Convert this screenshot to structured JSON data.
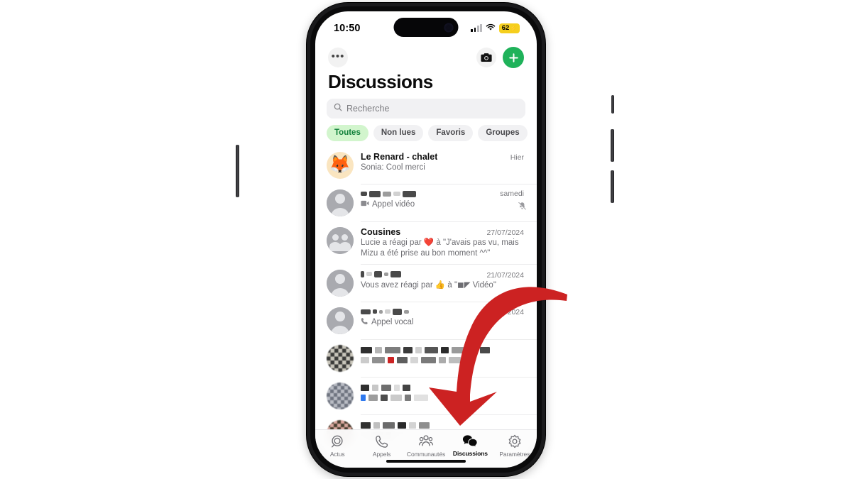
{
  "status_bar": {
    "time": "10:50",
    "battery_level": "62",
    "battery_charging_glyph": "⚡",
    "signal_icon": "cellular-bars-icon",
    "wifi_icon": "wifi-icon"
  },
  "top_nav": {
    "menu_icon": "more-options-icon",
    "menu_label": "•••",
    "camera_icon": "camera-icon",
    "compose_icon": "plus-icon"
  },
  "header": {
    "title": "Discussions"
  },
  "search": {
    "icon": "search-icon",
    "placeholder": "Recherche",
    "value": ""
  },
  "filters": [
    {
      "label": "Toutes",
      "active": true
    },
    {
      "label": "Non lues",
      "active": false
    },
    {
      "label": "Favoris",
      "active": false
    },
    {
      "label": "Groupes",
      "active": false
    }
  ],
  "chats": [
    {
      "name": "Le Renard - chalet",
      "name_redacted": false,
      "preview": "Sonia: Cool merci",
      "time": "Hier",
      "avatar": "fox-emoji-avatar",
      "avatar_emoji": "🦊",
      "muted": false
    },
    {
      "name": "",
      "name_redacted": true,
      "preview": "Appel vidéo",
      "preview_icon": "video-call-icon",
      "time": "samedi",
      "avatar": "person-placeholder-avatar",
      "muted": true,
      "muted_icon": "bell-muted-icon"
    },
    {
      "name": "Cousines",
      "name_redacted": false,
      "preview": "Lucie a réagi par ❤️ à \"J'avais pas vu, mais Mizu a été prise au bon moment ^^\"",
      "time": "27/07/2024",
      "avatar": "group-placeholder-avatar",
      "muted": false
    },
    {
      "name": "",
      "name_redacted": true,
      "preview": "Vous avez réagi par 👍 à \"◼◤ Vidéo\"",
      "time": "21/07/2024",
      "avatar": "person-placeholder-avatar",
      "muted": false
    },
    {
      "name": "",
      "name_redacted": true,
      "preview": "Appel vocal",
      "preview_icon": "voice-call-icon",
      "time": "11/07/2024",
      "avatar": "person-placeholder-avatar",
      "muted": false
    },
    {
      "name": "",
      "name_redacted": true,
      "preview": "",
      "time": "",
      "avatar": "pixelated-photo-avatar",
      "muted": false,
      "fully_pixelated": true
    },
    {
      "name": "",
      "name_redacted": true,
      "preview": "",
      "time": "",
      "avatar": "pixelated-photo-avatar",
      "muted": false,
      "fully_pixelated": true
    },
    {
      "name": "",
      "name_redacted": true,
      "preview": "",
      "time": "",
      "avatar": "pixelated-photo-avatar",
      "muted": false,
      "fully_pixelated": true
    }
  ],
  "tab_bar": [
    {
      "label": "Actus",
      "icon": "status-updates-icon",
      "active": false
    },
    {
      "label": "Appels",
      "icon": "phone-icon",
      "active": false
    },
    {
      "label": "Communautés",
      "icon": "communities-icon",
      "active": false
    },
    {
      "label": "Discussions",
      "icon": "chats-bubbles-icon",
      "active": true
    },
    {
      "label": "Paramètres",
      "icon": "gear-icon",
      "active": false
    }
  ],
  "annotation": {
    "type": "curved-arrow",
    "color": "#cc2222",
    "points_to": "Discussions"
  },
  "colors": {
    "accent_green": "#1fb25a",
    "chip_active_bg": "#d2f5cd",
    "chip_active_text": "#12803b",
    "arrow_red": "#cc2222",
    "battery_yellow": "#f5cf1e"
  }
}
